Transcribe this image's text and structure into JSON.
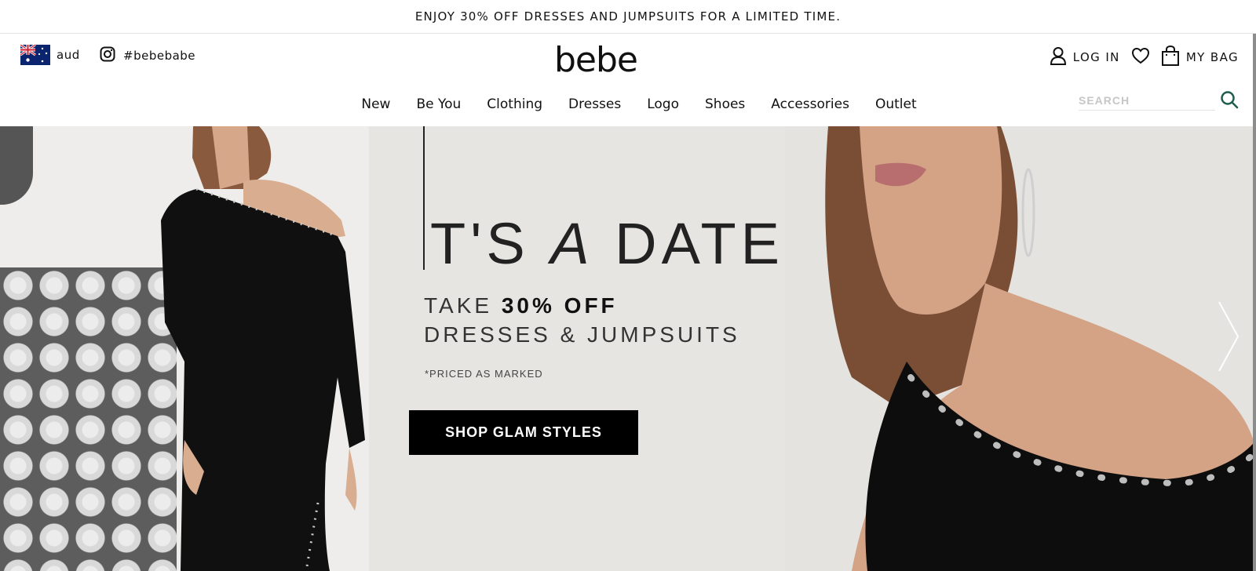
{
  "promo": {
    "text": "ENJOY 30% OFF DRESSES AND JUMPSUITS FOR A LIMITED TIME."
  },
  "header": {
    "currency": "aud",
    "hashtag": "#bebebabe",
    "logo": "bebe",
    "login_label": "LOG IN",
    "bag_label": "MY BAG"
  },
  "nav": {
    "items": [
      {
        "label": "New"
      },
      {
        "label": "Be You"
      },
      {
        "label": "Clothing"
      },
      {
        "label": "Dresses"
      },
      {
        "label": "Logo"
      },
      {
        "label": "Shoes"
      },
      {
        "label": "Accessories"
      },
      {
        "label": "Outlet"
      }
    ]
  },
  "search": {
    "placeholder": "SEARCH"
  },
  "hero": {
    "headline_part1": "T'S ",
    "headline_em": "A",
    "headline_part2": " DATE",
    "offer_line1_prefix": "TAKE ",
    "offer_line1_bold": "30% OFF",
    "offer_line2": "DRESSES & JUMPSUITS",
    "fine_print": "*PRICED AS MARKED",
    "cta_label": "SHOP GLAM STYLES"
  },
  "icons": {
    "flag": "australia-flag-icon",
    "instagram": "instagram-icon",
    "user": "user-icon",
    "heart": "heart-icon",
    "bag": "shopping-bag-icon",
    "search": "search-icon",
    "next": "chevron-right-icon"
  },
  "colors": {
    "search_icon": "#1e5c4c",
    "cta_bg": "#000000"
  }
}
